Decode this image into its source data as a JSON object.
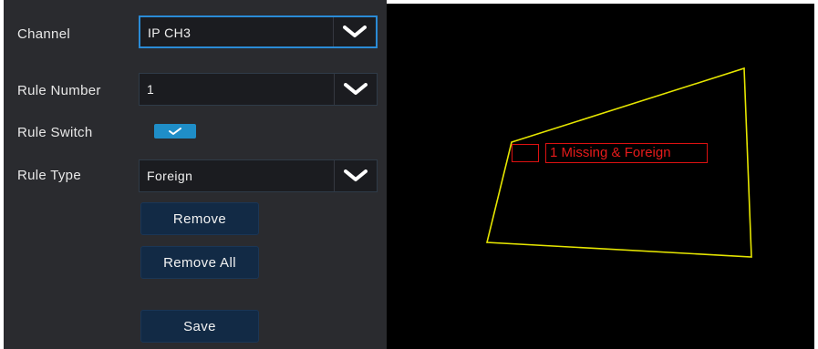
{
  "settings": {
    "channel": {
      "label": "Channel",
      "value": "IP CH3"
    },
    "rule_number": {
      "label": "Rule Number",
      "value": "1"
    },
    "rule_switch": {
      "label": "Rule Switch",
      "enabled": true
    },
    "rule_type": {
      "label": "Rule Type",
      "value": "Foreign"
    }
  },
  "buttons": {
    "remove": "Remove",
    "remove_all": "Remove All",
    "save": "Save"
  },
  "preview": {
    "region_label": "1 Missing & Foreign",
    "region_color": "#e6e600",
    "label_color": "#e61b1b"
  },
  "icons": {
    "dropdown": "chevron-down-icon",
    "check": "check-icon"
  }
}
